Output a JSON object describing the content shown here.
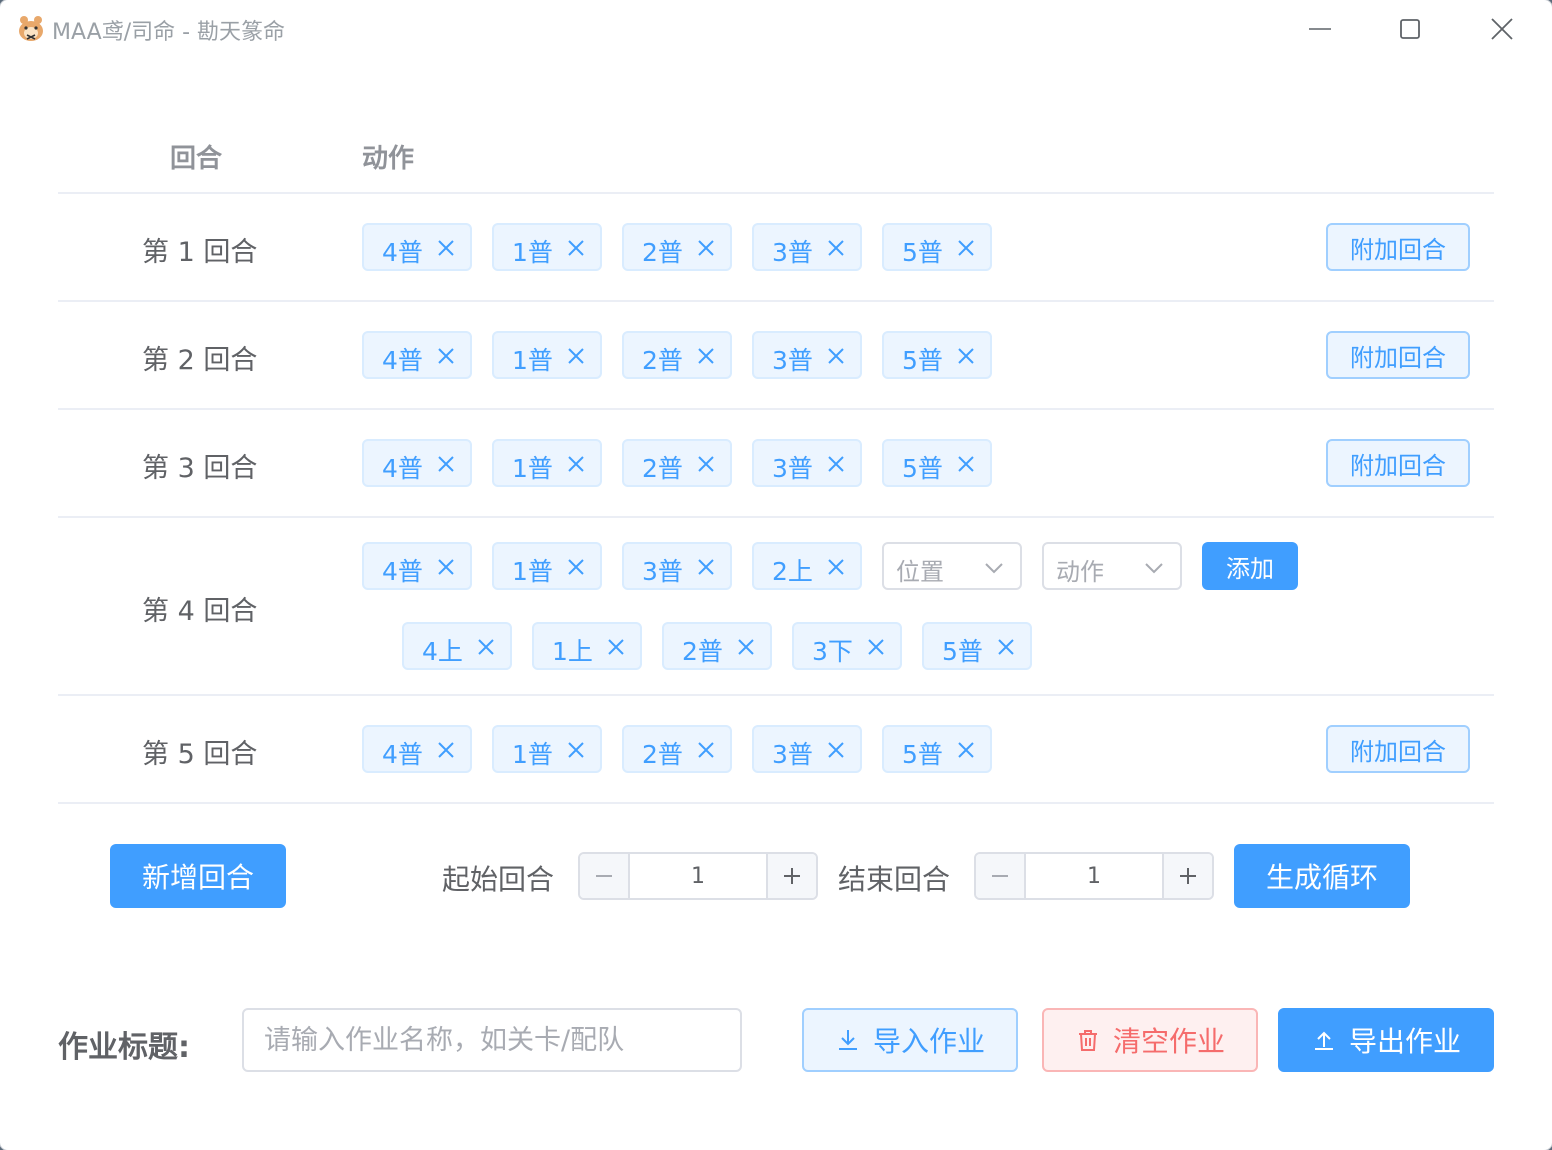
{
  "window": {
    "title": "MAA鸢/司命 - 勘天篆命",
    "app_icon": "hamster-app-icon",
    "controls": [
      "minimize-icon",
      "maximize-icon",
      "close-icon"
    ]
  },
  "table": {
    "headers": {
      "round": "回合",
      "action": "动作"
    },
    "rows": [
      {
        "label": "第 1 回合",
        "tags": [
          "4普",
          "1普",
          "2普",
          "3普",
          "5普"
        ],
        "append_label": "附加回合"
      },
      {
        "label": "第 2 回合",
        "tags": [
          "4普",
          "1普",
          "2普",
          "3普",
          "5普"
        ],
        "append_label": "附加回合"
      },
      {
        "label": "第 3 回合",
        "tags": [
          "4普",
          "1普",
          "2普",
          "3普",
          "5普"
        ],
        "append_label": "附加回合"
      },
      {
        "label": "第 4 回合",
        "tags": [
          "4普",
          "1普",
          "3普",
          "2上"
        ],
        "position_placeholder": "位置",
        "action_placeholder": "动作",
        "add_label": "添加",
        "extra_tags": [
          "4上",
          "1上",
          "2普",
          "3下",
          "5普"
        ]
      },
      {
        "label": "第 5 回合",
        "tags": [
          "4普",
          "1普",
          "2普",
          "3普",
          "5普"
        ],
        "append_label": "附加回合"
      }
    ]
  },
  "controls": {
    "new_round_label": "新增回合",
    "start_round_label": "起始回合",
    "start_round_value": "1",
    "end_round_label": "结束回合",
    "end_round_value": "1",
    "generate_loop_label": "生成循环"
  },
  "footer": {
    "title_label": "作业标题:",
    "title_placeholder": "请输入作业名称，如关卡/配队",
    "import_label": "导入作业",
    "clear_label": "清空作业",
    "export_label": "导出作业"
  },
  "colors": {
    "primary": "#409eff",
    "tag_bg": "#ecf5ff",
    "tag_border": "#d9ecff",
    "danger": "#f56c6c",
    "danger_bg": "#fef0f0",
    "text_regular": "#606266",
    "text_secondary": "#909399"
  }
}
